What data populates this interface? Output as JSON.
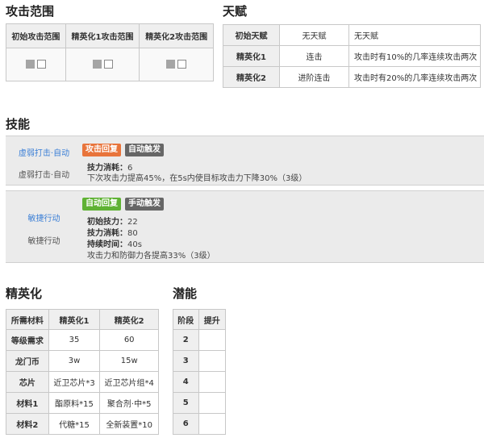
{
  "range": {
    "title": "攻击范围",
    "headers": [
      "初始攻击范围",
      "精英化1攻击范围",
      "精英化2攻击范围"
    ]
  },
  "talent": {
    "title": "天赋",
    "rows": [
      {
        "label": "初始天赋",
        "name": "无天赋",
        "desc": "无天赋"
      },
      {
        "label": "精英化1",
        "name": "连击",
        "desc": "攻击时有10%的几率连续攻击两次"
      },
      {
        "label": "精英化2",
        "name": "进阶连击",
        "desc": "攻击时有20%的几率连续攻击两次"
      }
    ]
  },
  "skills": {
    "title": "技能",
    "items": [
      {
        "link": "虚弱打击·自动",
        "name": "虚弱打击·自动",
        "badges": [
          "攻击回复",
          "自动触发"
        ],
        "lines": [
          {
            "label": "技力消耗：",
            "value": "6"
          },
          {
            "label": "",
            "value": "下次攻击力提高45%，在5s内使目标攻击力下降30%（3级）"
          }
        ]
      },
      {
        "link": "敏捷行动",
        "name": "敏捷行动",
        "badges": [
          "自动回复",
          "手动触发"
        ],
        "lines": [
          {
            "label": "初始技力：",
            "value": "22"
          },
          {
            "label": "技力消耗：",
            "value": "80"
          },
          {
            "label": "持续时间：",
            "value": "40s"
          },
          {
            "label": "",
            "value": "攻击力和防御力各提高33%（3级）"
          }
        ]
      }
    ]
  },
  "elite": {
    "title": "精英化",
    "headers": [
      "所需材料",
      "精英化1",
      "精英化2"
    ],
    "rows": [
      {
        "label": "等级需求",
        "e1": "35",
        "e2": "60"
      },
      {
        "label": "龙门币",
        "e1": "3w",
        "e2": "15w"
      },
      {
        "label": "芯片",
        "e1": "近卫芯片*3",
        "e2": "近卫芯片组*4"
      },
      {
        "label": "材料1",
        "e1": "酯原料*15",
        "e2": "聚合剂·中*5"
      },
      {
        "label": "材料2",
        "e1": "代糖*15",
        "e2": "全新装置*10"
      }
    ]
  },
  "potential": {
    "title": "潜能",
    "headers": [
      "阶段",
      "提升"
    ],
    "rows": [
      {
        "stage": "2",
        "value": ""
      },
      {
        "stage": "3",
        "value": ""
      },
      {
        "stage": "4",
        "value": ""
      },
      {
        "stage": "5",
        "value": ""
      },
      {
        "stage": "6",
        "value": ""
      }
    ]
  }
}
